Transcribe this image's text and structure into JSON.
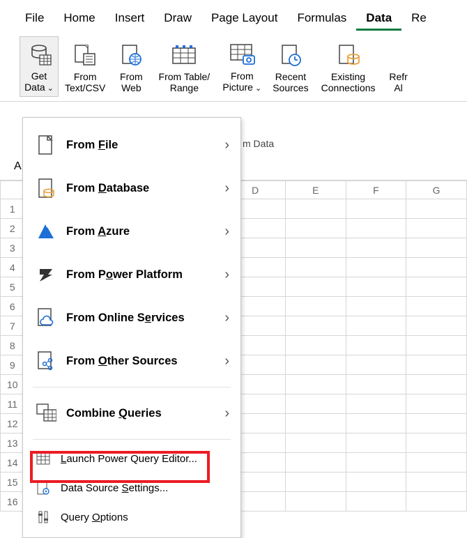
{
  "tabs": {
    "file": "File",
    "home": "Home",
    "insert": "Insert",
    "draw": "Draw",
    "pagelayout": "Page Layout",
    "formulas": "Formulas",
    "data": "Data",
    "re": "Re"
  },
  "ribbon": {
    "getdata": "Get\nData",
    "textcsv": "From\nText/CSV",
    "fromweb": "From\nWeb",
    "tablerange": "From Table/\nRange",
    "frompicture": "From\nPicture",
    "recent": "Recent\nSources",
    "existing": "Existing\nConnections",
    "refresh": "Refr\nAl"
  },
  "below": {
    "label": "m Data"
  },
  "namebox": {
    "val": "A"
  },
  "cols": [
    "D",
    "E",
    "F",
    "G"
  ],
  "rows": [
    "1",
    "2",
    "3",
    "4",
    "5",
    "6",
    "7",
    "8",
    "9",
    "10",
    "11",
    "12",
    "13",
    "14",
    "15",
    "16"
  ],
  "dd": {
    "file": "From File",
    "database": "From Database",
    "azure": "From Azure",
    "power": "From Power Platform",
    "online": "From Online Services",
    "other": "From Other Sources",
    "combine": "Combine Queries",
    "launch": "Launch Power Query Editor...",
    "settings": "Data Source Settings...",
    "options": "Query Options",
    "underline": {
      "file": "F",
      "database": "D",
      "azure": "A",
      "power": "o",
      "online": "e",
      "other": "O",
      "combine": "Q",
      "launch": "L",
      "settings": "S",
      "options": "O"
    }
  }
}
